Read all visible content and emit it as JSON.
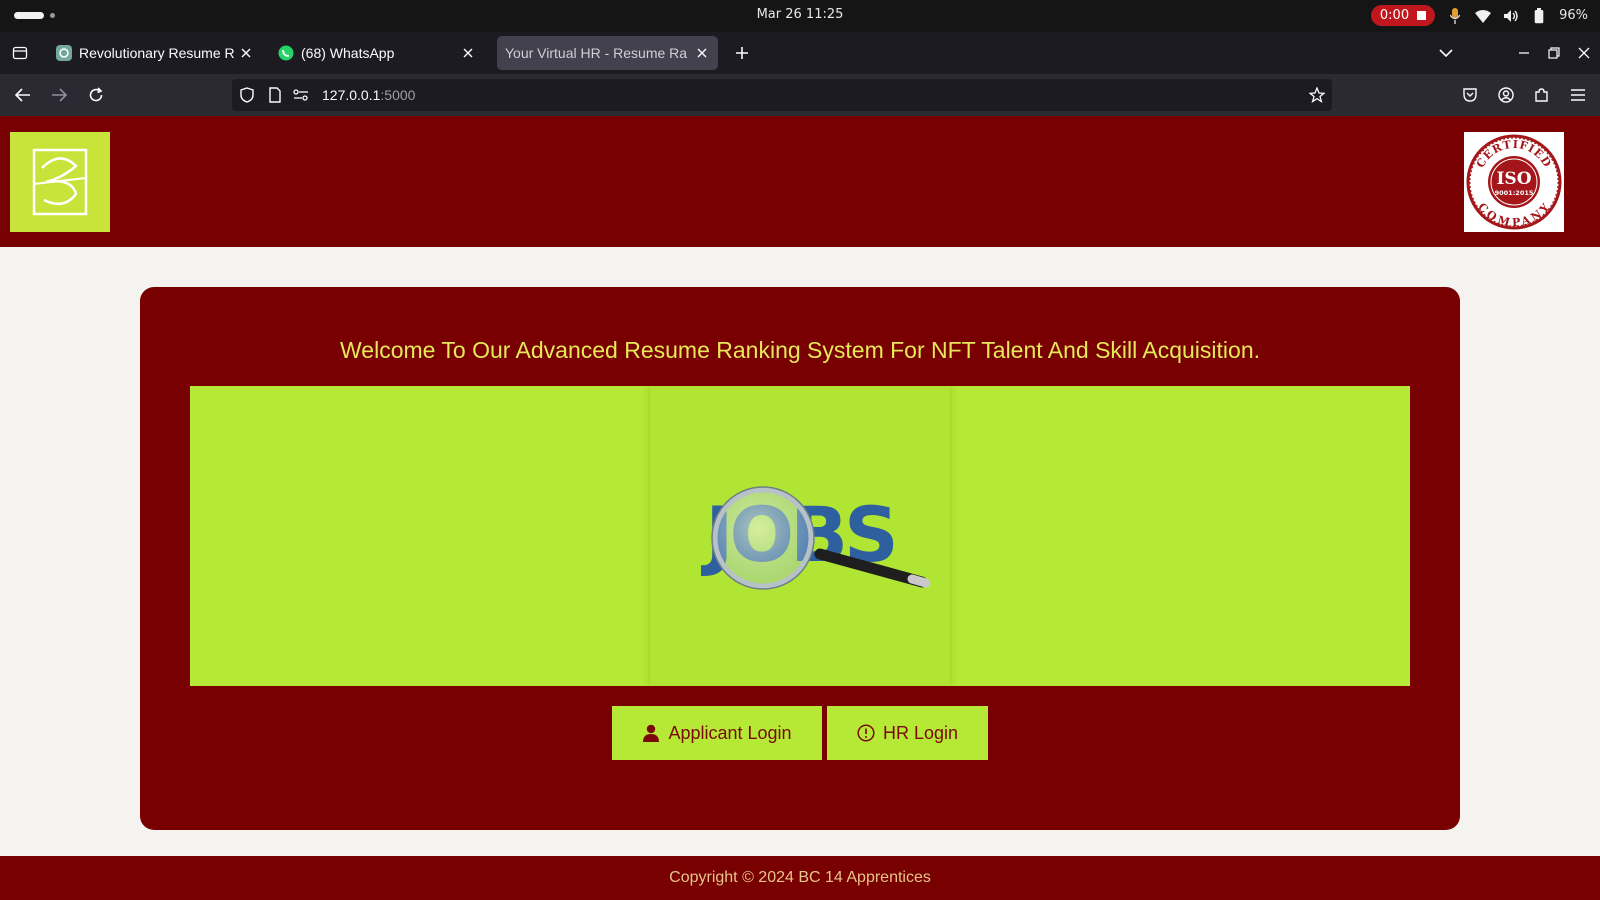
{
  "os": {
    "date_time": "Mar 26  11:25",
    "recording_time": "0:00",
    "battery": "96%"
  },
  "browser": {
    "tabs": [
      {
        "title": "Revolutionary Resume Ra",
        "favicon": "chatgpt-icon",
        "active": false
      },
      {
        "title": "(68) WhatsApp",
        "favicon": "whatsapp-icon",
        "active": false
      },
      {
        "title": "Your Virtual HR - Resume Ra",
        "favicon": "",
        "active": true
      }
    ],
    "url_host": "127.0.0.1",
    "url_port": ":5000"
  },
  "page": {
    "welcome": "Welcome To Our Advanced Resume Ranking System For NFT Talent And Skill Acquisition.",
    "banner_word": "JOBS",
    "buttons": {
      "applicant": "Applicant Login",
      "hr": "HR Login"
    },
    "iso": {
      "top": "CERTIFIED",
      "mid": "ISO",
      "num": "9001:2015",
      "bottom": "COMPANY"
    },
    "footer": "Copyright © 2024 BC 14 Apprentices"
  },
  "colors": {
    "brand_red": "#780000",
    "accent_green": "#b5e935",
    "welcome_text": "#e6e85a"
  }
}
